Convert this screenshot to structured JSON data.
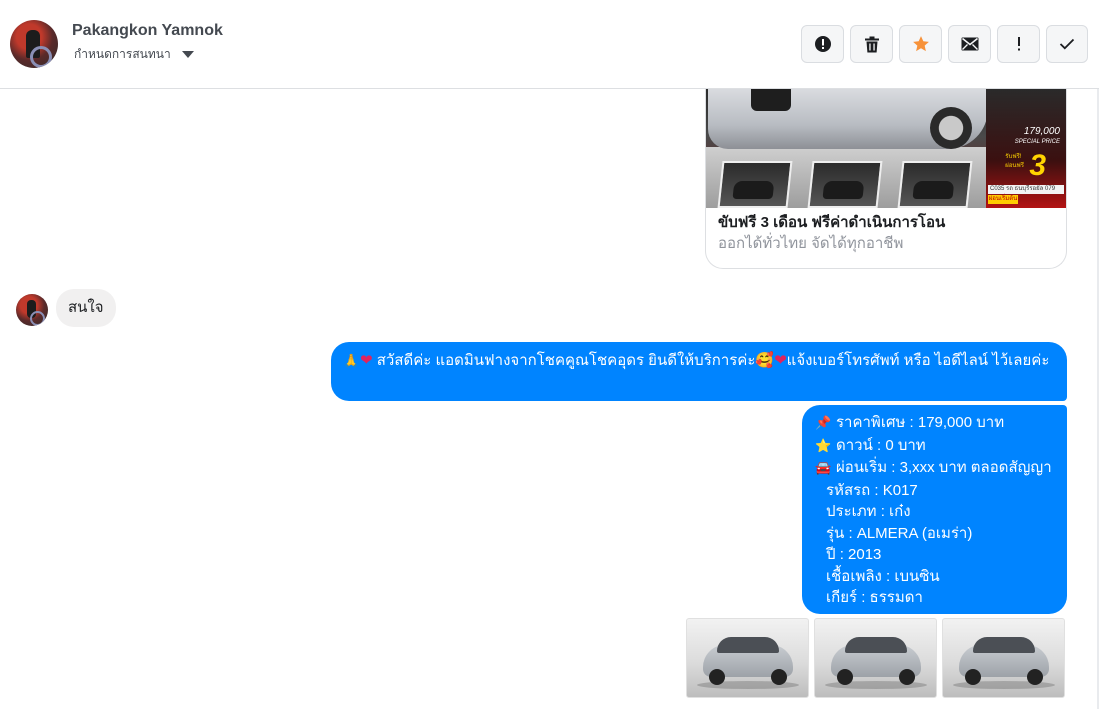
{
  "header": {
    "name": "Pakangkon Yamnok",
    "subtitle": "กำหนดการสนทนา",
    "toolbar": [
      {
        "icon": "alert-circle-icon"
      },
      {
        "icon": "trash-icon"
      },
      {
        "icon": "star-icon",
        "color": "#f7923a"
      },
      {
        "icon": "envelope-icon"
      },
      {
        "icon": "exclamation-icon"
      },
      {
        "icon": "check-icon"
      }
    ]
  },
  "shared_post": {
    "title": "ขับฟรี 3 เดือน ฟรีค่าดำเนินการโอน",
    "subtitle": "ออกได้ทั่วไทย จัดได้ทุกอาชีพ",
    "promo_price": "179,000",
    "promo_price_label": "SPECIAL PRICE",
    "promo_number": "3",
    "promo_label_top": "รับฟรี!",
    "promo_label_bottom": "ผ่อนฟรี",
    "promo_code": "C035 รถ ธนบุรีรอยัล 079",
    "promo_tag": "ผ่อนเริ่มต้น"
  },
  "incoming_message": {
    "text": "สนใจ"
  },
  "outgoing_messages": [
    {
      "text": "สวัสดีค่ะ แอดมินฟางจากโชคคูณโชคอุดร ยินดีให้บริการค่ะ",
      "text2": "แจ้งเบอร์โทรศัพท์ หรือ ไอดีไลน์  ไว้เลยค่ะ"
    },
    {
      "lines": [
        {
          "emoji": "📌",
          "text": "ราคาพิเศษ : 179,000 บาท"
        },
        {
          "emoji": "⭐",
          "text": "ดาวน์ : 0 บาท"
        },
        {
          "emoji": "🚘",
          "text": "ผ่อนเริ่ม : 3,xxx บาท ตลอดสัญญา"
        },
        {
          "emoji": "",
          "text": "รหัสรถ : K017"
        },
        {
          "emoji": "",
          "text": "ประเภท : เก๋ง"
        },
        {
          "emoji": "",
          "text": "รุ่น : ALMERA (อเมร่า)"
        },
        {
          "emoji": "",
          "text": "ปี : 2013"
        },
        {
          "emoji": "",
          "text": "เชื้อเพลิง : เบนซิน"
        },
        {
          "emoji": "",
          "text": "เกียร์ : ธรรมดา"
        }
      ]
    }
  ],
  "colors": {
    "outgoing_bubble": "#0084ff",
    "incoming_bubble": "#f1f0f0",
    "star": "#f7923a"
  }
}
